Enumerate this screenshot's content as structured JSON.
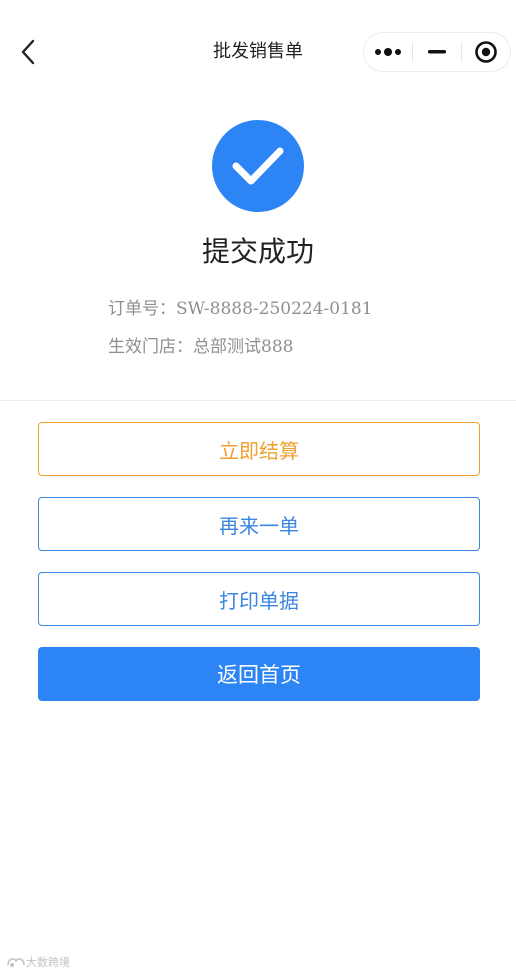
{
  "navbar": {
    "title": "批发销售单",
    "back_icon": "chevron-left-icon",
    "more_icon": "more-dots-icon",
    "minimize_icon": "minimize-icon",
    "close_icon": "target-close-icon"
  },
  "result": {
    "icon": "check-circle-icon",
    "title": "提交成功",
    "order_no_label": "订单号：",
    "order_no_value": "SW-8888-250224-0181",
    "store_label": "生效门店：",
    "store_value": "总部测试888"
  },
  "actions": {
    "settle_label": "立即结算",
    "again_label": "再来一单",
    "print_label": "打印单据",
    "home_label": "返回首页"
  },
  "watermark": {
    "text": "大数跨境",
    "icon": "brand-logo-icon"
  },
  "colors": {
    "primary": "#2d84f5",
    "settle_orange": "#f0a030",
    "outline_blue": "#3a86e0"
  }
}
